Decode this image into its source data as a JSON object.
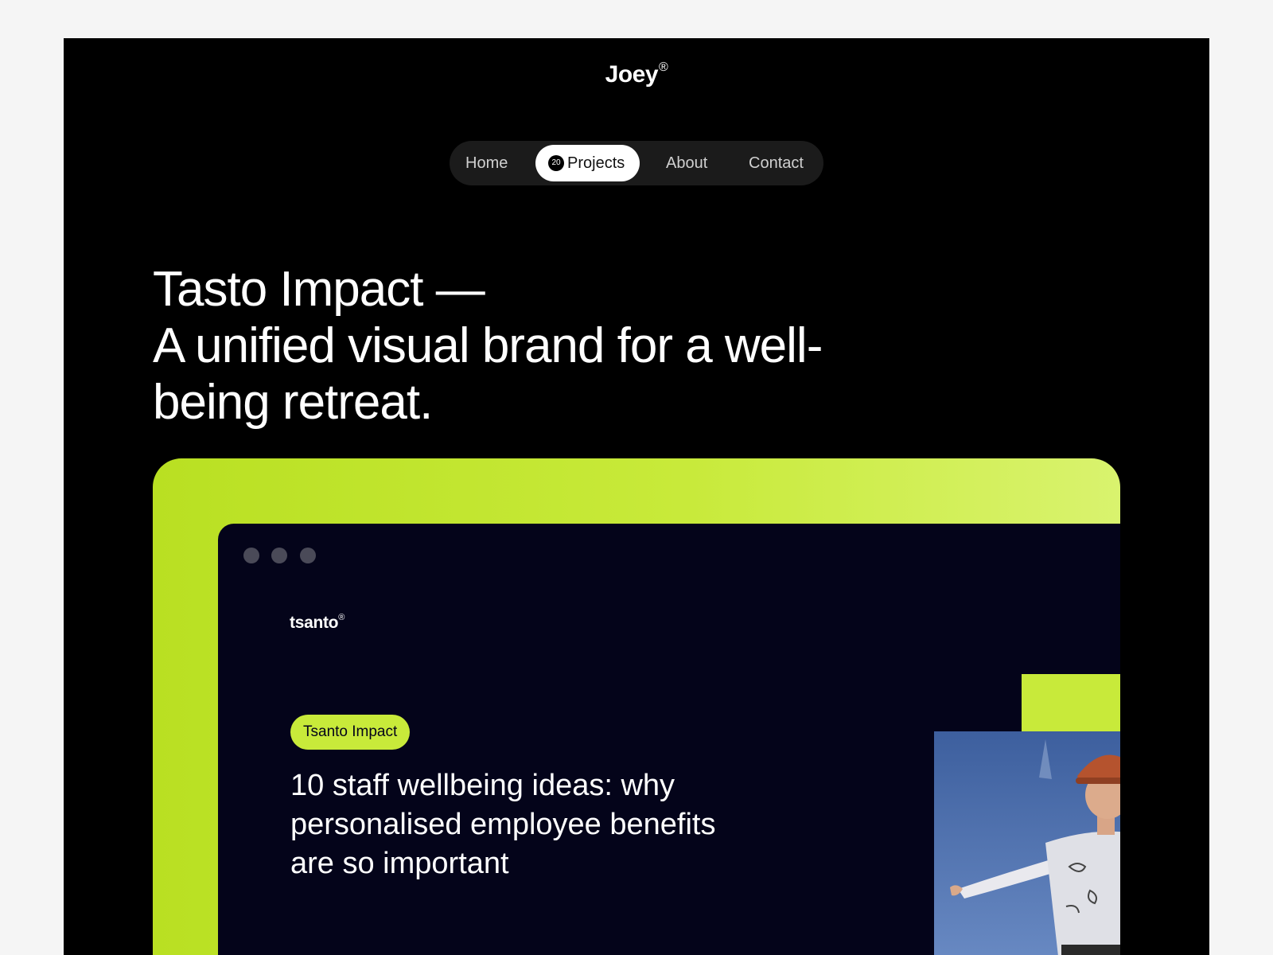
{
  "site": {
    "logo": "Joey",
    "logo_mark": "®"
  },
  "nav": {
    "items": [
      {
        "label": "Home"
      },
      {
        "label": "Projects",
        "count": "20",
        "active": true
      },
      {
        "label": "About"
      },
      {
        "label": "Contact"
      }
    ]
  },
  "hero": {
    "headline_line1": "Tasto Impact —",
    "headline_line2": "A unified visual brand for a well-",
    "headline_line3": "being retreat."
  },
  "preview": {
    "brand": "tsanto",
    "brand_mark": "®",
    "tag": "Tsanto Impact",
    "title_line1": "10 staff wellbeing ideas: why",
    "title_line2": "personalised employee benefits",
    "title_line3": "are so important"
  },
  "colors": {
    "page_bg": "#f5f5f5",
    "frame_bg": "#000000",
    "accent_lime": "#c8ea3a",
    "browser_bg": "#04041a",
    "nav_bg": "#1b1b1b"
  },
  "icons": {
    "window_controls": [
      "window-dot-icon",
      "window-dot-icon",
      "window-dot-icon"
    ]
  }
}
